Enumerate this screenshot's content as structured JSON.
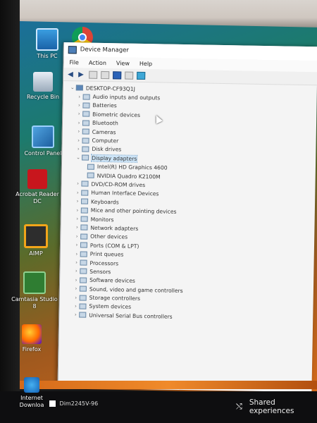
{
  "desktop": {
    "icons": [
      {
        "label": "This PC",
        "icon": "this-pc-icon"
      },
      {
        "label": "Recycle Bin",
        "icon": "recycle-bin-icon"
      },
      {
        "label": "Control Panel",
        "icon": "control-panel-icon"
      },
      {
        "label": "Acrobat Reader DC",
        "icon": "acrobat-icon"
      },
      {
        "label": "AIMP",
        "icon": "aimp-icon"
      },
      {
        "label": "Camtasia Studio 8",
        "icon": "camtasia-icon"
      },
      {
        "label": "Firefox",
        "icon": "firefox-icon"
      }
    ],
    "chrome_icon": "chrome-icon"
  },
  "window": {
    "title": "Device Manager",
    "menu": [
      "File",
      "Action",
      "View",
      "Help"
    ],
    "tree": {
      "root": "DESKTOP-CF93Q1J",
      "categories": [
        "Audio inputs and outputs",
        "Batteries",
        "Biometric devices",
        "Bluetooth",
        "Cameras",
        "Computer",
        "Disk drives",
        "Display adapters",
        "DVD/CD-ROM drives",
        "Human Interface Devices",
        "Keyboards",
        "Mice and other pointing devices",
        "Monitors",
        "Network adapters",
        "Other devices",
        "Ports (COM & LPT)",
        "Print queues",
        "Processors",
        "Sensors",
        "Software devices",
        "Sound, video and game controllers",
        "Storage controllers",
        "System devices",
        "Universal Serial Bus controllers"
      ],
      "display_children": [
        "Intel(R) HD Graphics 4600",
        "NVIDIA Quadro K2100M"
      ]
    }
  },
  "taskbar": {
    "left_label": "Internet Downloa",
    "file_label": "Dim2245V-96",
    "notification": "Shared experiences"
  }
}
